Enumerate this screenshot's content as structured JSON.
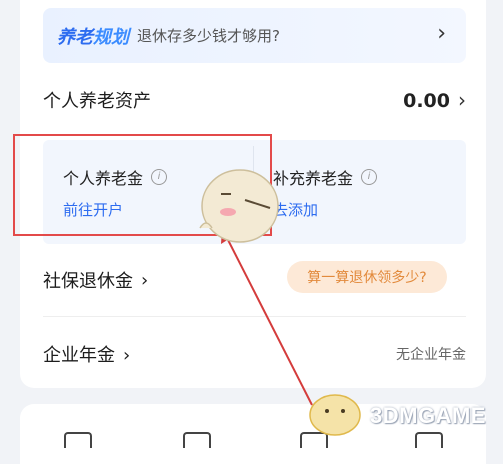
{
  "banner": {
    "brand_1": "养老",
    "brand_2": "规划",
    "subtitle": "退休存多少钱才够用?",
    "chevron": "›"
  },
  "assets": {
    "label": "个人养老资产",
    "value": "0.00",
    "chevron": "›"
  },
  "personal_pension": {
    "title": "个人养老金",
    "info": "i",
    "link": "前往开户"
  },
  "supplementary_pension": {
    "title": "补充养老金",
    "info": "i",
    "link": "去添加"
  },
  "social_security": {
    "label": "社保退休金",
    "chevron": "›",
    "calc_button": "算一算退休领多少?"
  },
  "enterprise": {
    "label": "企业年金",
    "chevron": "›",
    "status": "无企业年金"
  },
  "watermark": {
    "text": "3DMGAME"
  },
  "colors": {
    "accent": "#2d6cf0",
    "highlight_frame": "#e34a4a",
    "pill_bg": "#fde9d7",
    "pill_text": "#e28a3c"
  }
}
